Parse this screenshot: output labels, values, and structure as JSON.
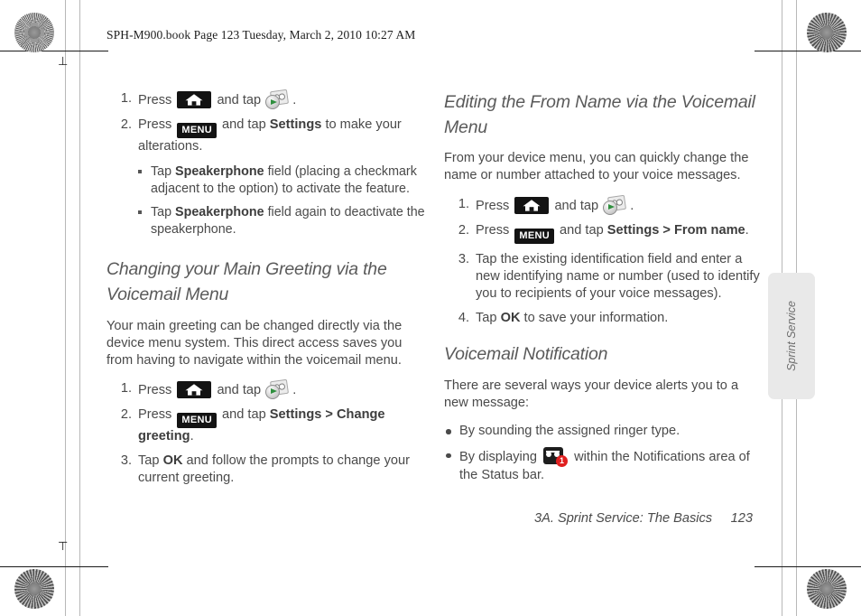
{
  "running_header": "SPH-M900.book  Page 123  Tuesday, March 2, 2010  10:27 AM",
  "icons": {
    "home_key": "home-key-icon",
    "menu_key": "MENU",
    "voicemail_app": "voicemail-app-icon",
    "voicemail_notification": "voicemail-notification-icon",
    "notification_badge_count": "1"
  },
  "left_column": {
    "top_steps": [
      {
        "num": "1.",
        "before_home": "Press",
        "between": "and tap",
        "after": "."
      },
      {
        "num": "2.",
        "before_menu": "Press",
        "between": "and tap",
        "keyword": "Settings",
        "after": "to make your alterations.",
        "subbullets": [
          {
            "lead": "Tap",
            "keyword": "Speakerphone",
            "rest": "field (placing a checkmark adjacent to the option) to activate the feature."
          },
          {
            "lead": "Tap",
            "keyword": "Speakerphone",
            "rest": "field again to deactivate the speakerphone."
          }
        ]
      }
    ],
    "section_heading": "Changing your Main Greeting via the Voicemail Menu",
    "section_paragraph": "Your main greeting can be changed directly via the device menu system. This direct access saves you from having to navigate within the voicemail menu.",
    "steps": [
      {
        "num": "1.",
        "before_home": "Press",
        "between": "and tap",
        "after": "."
      },
      {
        "num": "2.",
        "before_menu": "Press",
        "between": "and tap",
        "keyword": "Settings > Change greeting",
        "after": "."
      },
      {
        "num": "3.",
        "lead": "Tap",
        "keyword": "OK",
        "rest": "and follow the prompts to change your current greeting."
      }
    ]
  },
  "right_column": {
    "section_heading": "Editing the From Name via the Voicemail Menu",
    "section_paragraph": "From your device menu, you can quickly change the name or number attached to your voice messages.",
    "steps": [
      {
        "num": "1.",
        "before_home": "Press",
        "between": "and tap",
        "after": "."
      },
      {
        "num": "2.",
        "before_menu": "Press",
        "between": "and tap",
        "keyword": "Settings > From name",
        "after": "."
      },
      {
        "num": "3.",
        "text": "Tap the existing identification field and enter a new identifying name or number (used to identify you to recipients of your voice messages)."
      },
      {
        "num": "4.",
        "lead": "Tap",
        "keyword": "OK",
        "rest": "to save your information."
      }
    ],
    "notification_heading": "Voicemail Notification",
    "notification_paragraph": "There are several ways your device alerts you to a new message:",
    "notification_bullets": [
      {
        "text": "By sounding the assigned ringer type."
      },
      {
        "before_icon": "By displaying",
        "after_icon": "within the Notifications area of the Status bar."
      }
    ]
  },
  "thumb_tab": {
    "label": "Sprint Service"
  },
  "footer": {
    "title": "3A. Sprint Service: The Basics",
    "page_number": "123"
  },
  "colors": {
    "key_black": "#131313",
    "badge_red": "#e02020",
    "heading_gray": "#5a5a5a",
    "tab_gray": "#e9e9e9"
  }
}
